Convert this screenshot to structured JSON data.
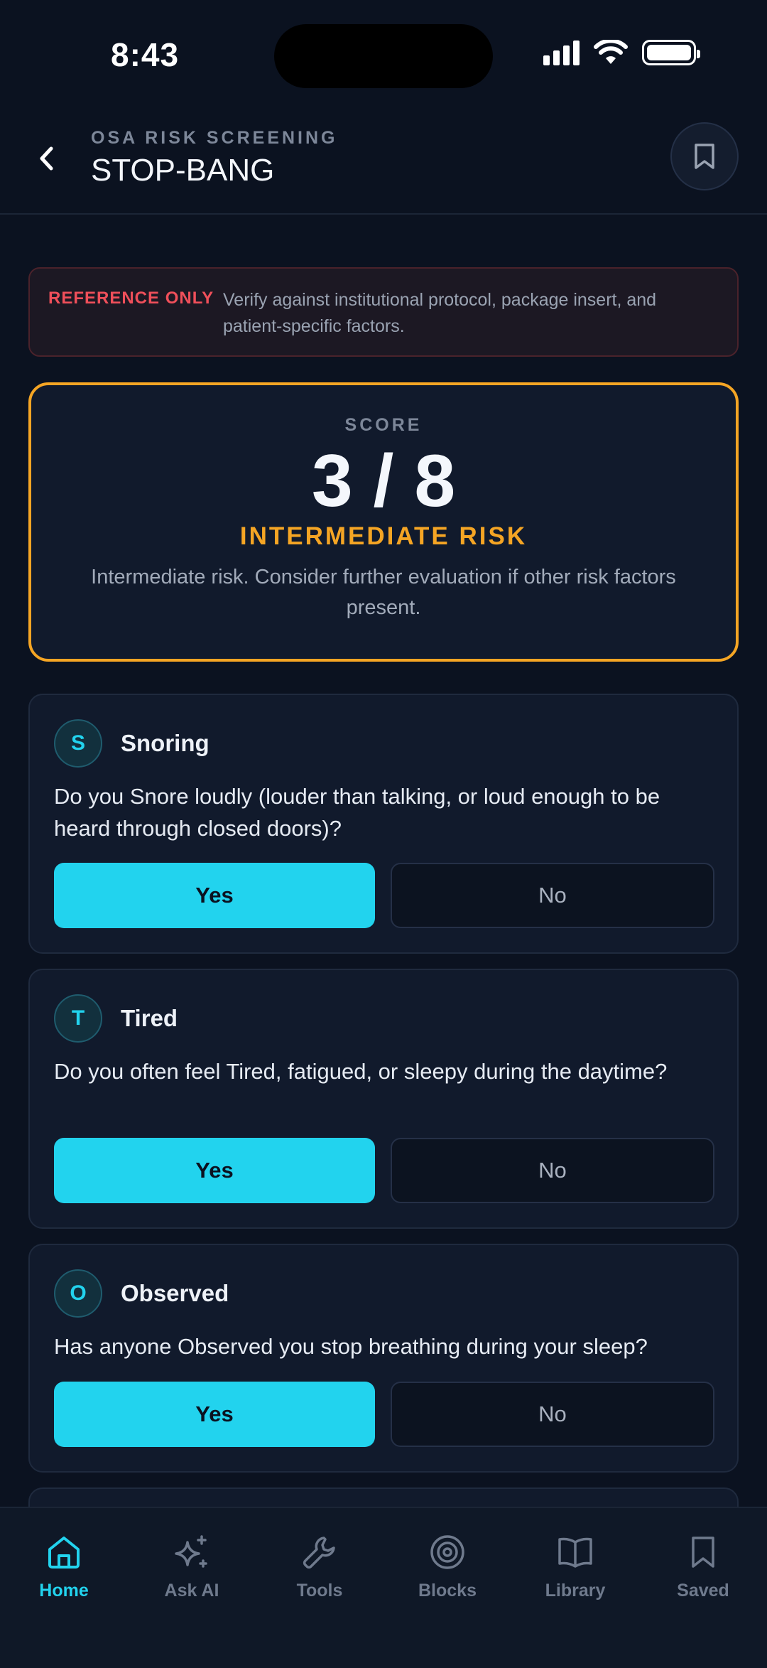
{
  "status_bar": {
    "time": "8:43"
  },
  "header": {
    "eyebrow": "OSA RISK SCREENING",
    "title": "STOP-BANG"
  },
  "reference": {
    "tag": "REFERENCE ONLY",
    "text": "Verify against institutional protocol, package insert, and patient-specific factors."
  },
  "score": {
    "label": "SCORE",
    "value": "3 / 8",
    "risk": "INTERMEDIATE RISK",
    "description": "Intermediate risk. Consider further evaluation if other risk factors present."
  },
  "questions": [
    {
      "letter": "S",
      "title": "Snoring",
      "text": "Do you Snore loudly (louder than talking, or loud enough to be heard through closed doors)?",
      "yes_label": "Yes",
      "no_label": "No",
      "selected": "Yes"
    },
    {
      "letter": "T",
      "title": "Tired",
      "text": "Do you often feel Tired, fatigued, or sleepy during the daytime?",
      "yes_label": "Yes",
      "no_label": "No",
      "selected": "Yes"
    },
    {
      "letter": "O",
      "title": "Observed",
      "text": "Has anyone Observed you stop breathing during your sleep?",
      "yes_label": "Yes",
      "no_label": "No",
      "selected": "Yes"
    }
  ],
  "tabs": [
    {
      "label": "Home",
      "icon": "home-icon",
      "active": true
    },
    {
      "label": "Ask AI",
      "icon": "sparkle-icon",
      "active": false
    },
    {
      "label": "Tools",
      "icon": "wrench-icon",
      "active": false
    },
    {
      "label": "Blocks",
      "icon": "target-icon",
      "active": false
    },
    {
      "label": "Library",
      "icon": "book-icon",
      "active": false
    },
    {
      "label": "Saved",
      "icon": "bookmark-icon",
      "active": false
    }
  ],
  "colors": {
    "background": "#0b1220",
    "accent": "#22d3ee",
    "warning": "#f5a524",
    "danger": "#ef4f5a"
  }
}
